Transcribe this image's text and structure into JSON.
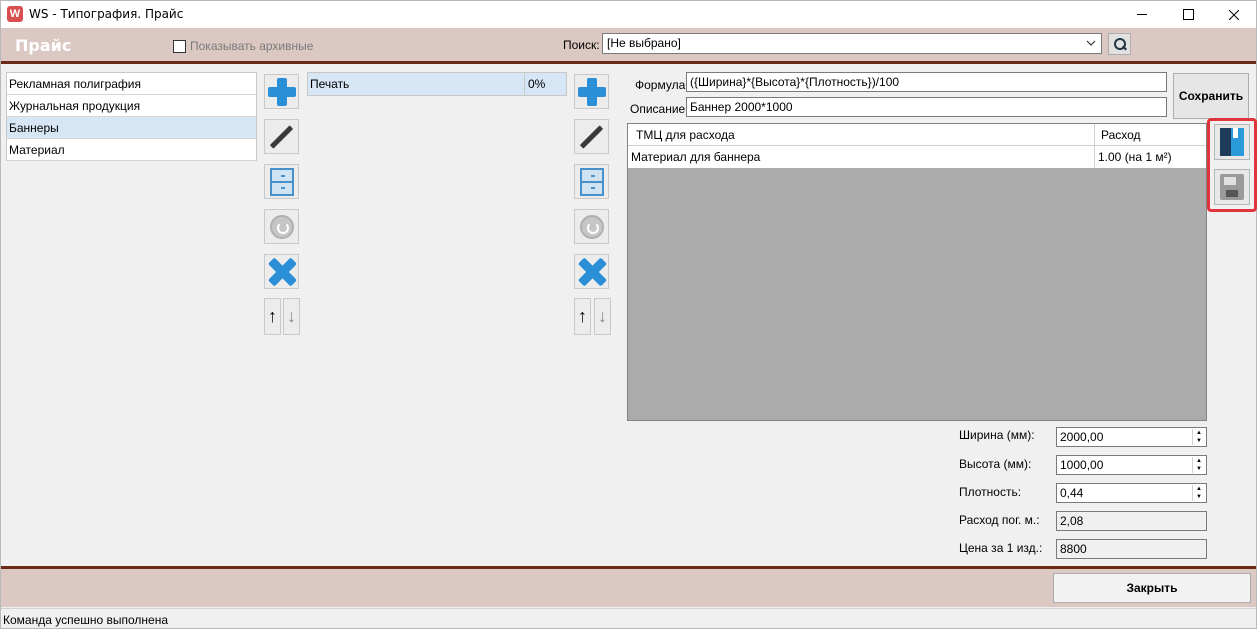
{
  "window": {
    "title": "WS - Типография. Прайс",
    "app_icon_letter": "W"
  },
  "header": {
    "title": "Прайс",
    "show_archived_label": "Показывать архивные",
    "show_archived_checked": false,
    "search_label": "Поиск:",
    "search_value": "[Не выбрано]"
  },
  "categories": {
    "items": [
      {
        "label": "Рекламная полиграфия",
        "selected": false
      },
      {
        "label": "Журнальная продукция",
        "selected": false
      },
      {
        "label": "Баннеры",
        "selected": true
      },
      {
        "label": "Материал",
        "selected": false
      }
    ]
  },
  "services": {
    "items": [
      {
        "label": "Печать",
        "percent": "0%",
        "selected": true
      }
    ]
  },
  "toolbar": {
    "icons": [
      "plus-icon",
      "pencil-icon",
      "cabinet-icon",
      "restore-icon",
      "delete-icon"
    ],
    "move_up": "↑",
    "move_down": "↓"
  },
  "formula": {
    "formula_label": "Формула:",
    "formula_value": "({Ширина}*{Высота}*{Плотность})/100",
    "description_label": "Описание:",
    "description_value": "Баннер 2000*1000",
    "save_label": "Сохранить"
  },
  "materials_table": {
    "columns": [
      "ТМЦ для расхода",
      "Расход"
    ],
    "rows": [
      [
        "Материал для баннера",
        "1.00 (на 1 м²)"
      ]
    ]
  },
  "parameters": {
    "width_label": "Ширина (мм):",
    "width_value": "2000,00",
    "height_label": "Высота (мм):",
    "height_value": "1000,00",
    "density_label": "Плотность:",
    "density_value": "0,44",
    "linear_label": "Расход пог. м.:",
    "linear_value": "2,08",
    "price_label": "Цена за 1 изд.:",
    "price_value": "8800"
  },
  "footer": {
    "close_label": "Закрыть",
    "status_text": "Команда успешно выполнена"
  },
  "colors": {
    "header_bg": "#dbc8c3",
    "accent_line": "#6b2a16",
    "selection": "#d6e6f5",
    "highlight_frame": "#e0353a"
  }
}
